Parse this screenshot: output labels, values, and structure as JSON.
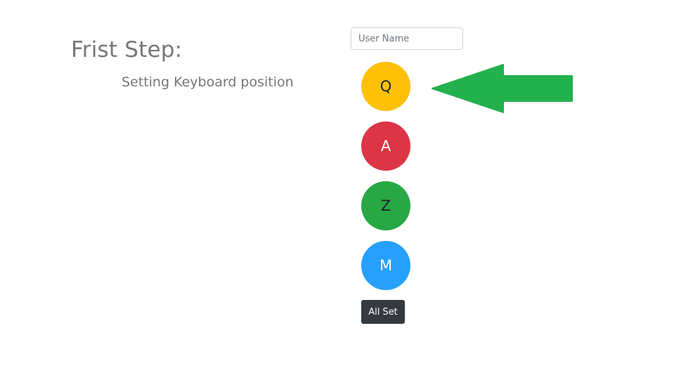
{
  "heading": {
    "title": "Frist Step:",
    "subtitle": "Setting Keyboard position"
  },
  "form": {
    "username_placeholder": "User Name",
    "username_value": ""
  },
  "keys": [
    {
      "label": "Q",
      "color": "#ffc107"
    },
    {
      "label": "A",
      "color": "#dc3545"
    },
    {
      "label": "Z",
      "color": "#28a745"
    },
    {
      "label": "M",
      "color": "#26a0fc"
    }
  ],
  "actions": {
    "all_set_label": "All Set"
  },
  "pointer": {
    "icon": "left-arrow-icon",
    "color": "#22b14c"
  }
}
